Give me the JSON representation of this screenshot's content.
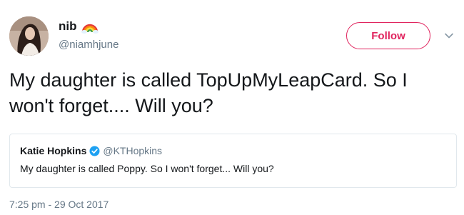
{
  "author": {
    "display_name": "nib",
    "handle": "@niamhjune",
    "name_emoji": "rainbow-icon"
  },
  "actions": {
    "follow_label": "Follow",
    "menu_icon": "chevron-down-icon"
  },
  "tweet": {
    "text": "My daughter is called TopUpMyLeapCard. So I won't forget.... Will you?",
    "timestamp": "7:25 pm - 29 Oct 2017"
  },
  "quoted_tweet": {
    "display_name": "Katie Hopkins",
    "verified": true,
    "handle": "@KTHopkins",
    "text": "My daughter is called Poppy. So I won't forget... Will you?"
  },
  "colors": {
    "follow_accent": "#e0245e",
    "verified_blue": "#1da1f2",
    "secondary_text": "#657786",
    "primary_text": "#14171a",
    "border": "#e1e8ed"
  }
}
